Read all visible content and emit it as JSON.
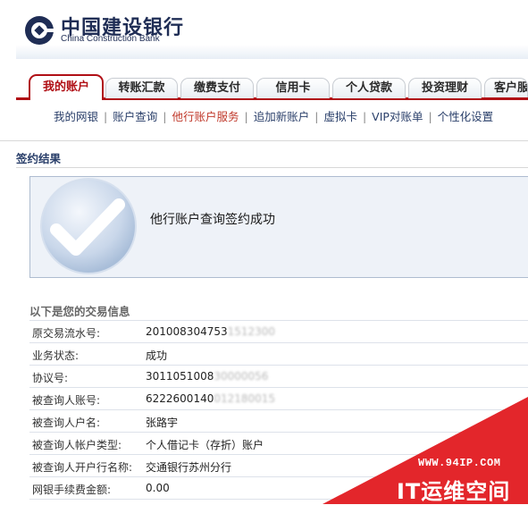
{
  "brand": {
    "name_cn": "中国建设银行",
    "name_en": "China Construction Bank",
    "color": "#1f2d55"
  },
  "tabs": [
    {
      "label": "我的账户",
      "active": true
    },
    {
      "label": "转账汇款"
    },
    {
      "label": "缴费支付"
    },
    {
      "label": "信用卡"
    },
    {
      "label": "个人贷款"
    },
    {
      "label": "投资理财"
    },
    {
      "label": "客户服"
    }
  ],
  "subnav": [
    {
      "label": "我的网银"
    },
    {
      "label": "账户查询"
    },
    {
      "label": "他行账户服务",
      "current": true
    },
    {
      "label": "追加新账户"
    },
    {
      "label": "虚拟卡"
    },
    {
      "label": "VIP对账单"
    },
    {
      "label": "个性化设置"
    }
  ],
  "section_title": "签约结果",
  "result": {
    "message": "他行账户查询签约成功",
    "icon": "checkmark-icon"
  },
  "info": {
    "heading": "以下是您的交易信息",
    "rows": [
      {
        "label": "原交易流水号:",
        "value": "2010083047531512300",
        "visible": "201008304753",
        "obscured": "1512300"
      },
      {
        "label": "业务状态:",
        "value": "成功"
      },
      {
        "label": "协议号:",
        "value": "301105100830000056",
        "visible": "3011051008",
        "obscured": "30000056"
      },
      {
        "label": "被查询人账号:",
        "value": "6222600140012180015",
        "visible": "6222600140",
        "obscured": "012180015"
      },
      {
        "label": "被查询人户名:",
        "value": "张路宇"
      },
      {
        "label": "被查询人帐户类型:",
        "value": "个人借记卡（存折）账户"
      },
      {
        "label": "被查询人开户行名称:",
        "value": "交通银行苏州分行"
      },
      {
        "label": "网银手续费金额:",
        "value": "0.00"
      }
    ]
  },
  "watermark": {
    "url": "WWW.94IP.COM",
    "name": "IT运维空间",
    "color": "#e3262b"
  },
  "colors": {
    "accent": "#b00f15",
    "link": "#2a3f6a"
  }
}
